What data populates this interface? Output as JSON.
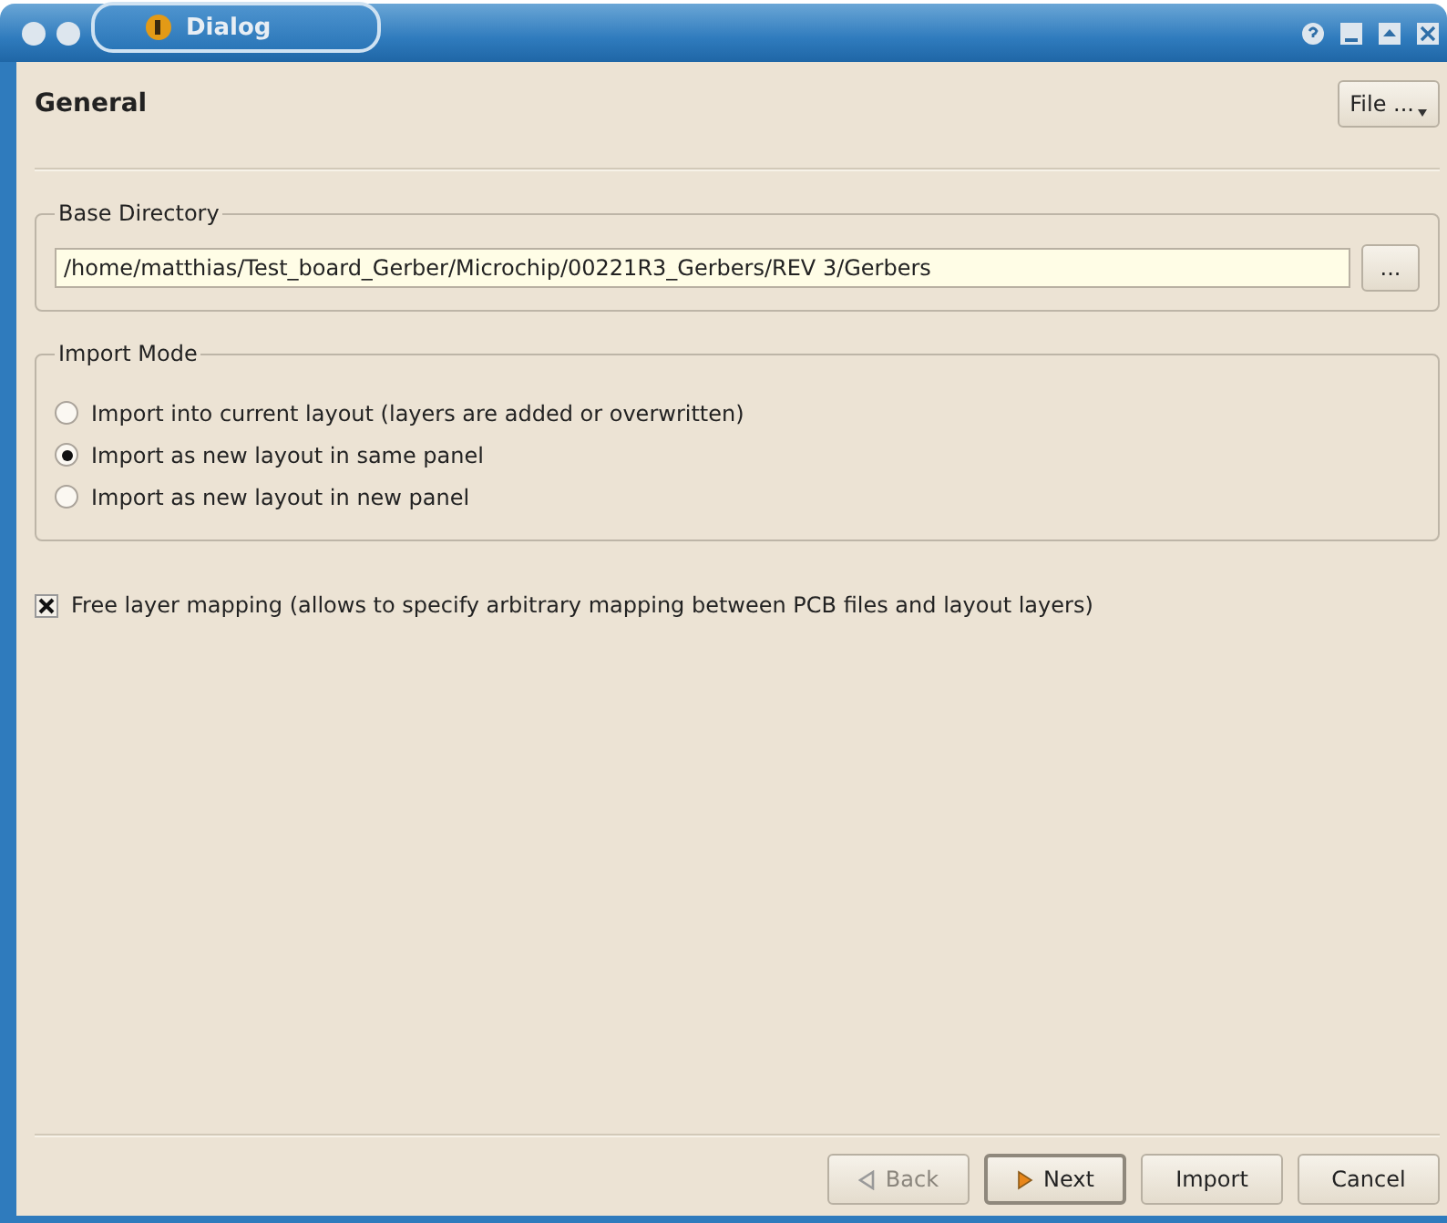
{
  "window": {
    "title": "Dialog"
  },
  "page": {
    "title": "General",
    "file_button": "File ..."
  },
  "base_directory": {
    "label": "Base Directory",
    "value": "/home/matthias/Test_board_Gerber/Microchip/00221R3_Gerbers/REV 3/Gerbers",
    "browse_button": "..."
  },
  "import_mode": {
    "label": "Import Mode",
    "options": [
      {
        "label": "Import into current layout (layers are added or overwritten)",
        "selected": false
      },
      {
        "label": "Import as new layout in same panel",
        "selected": true
      },
      {
        "label": "Import as new layout in new panel",
        "selected": false
      }
    ]
  },
  "free_layer_mapping": {
    "label": "Free layer mapping (allows to specify arbitrary mapping between PCB files and layout layers)",
    "checked": true
  },
  "buttons": [
    {
      "label": "Back",
      "kind": "back",
      "disabled": true,
      "default": false
    },
    {
      "label": "Next",
      "kind": "next",
      "disabled": false,
      "default": true
    },
    {
      "label": "Import",
      "kind": "plain",
      "disabled": false,
      "default": false
    },
    {
      "label": "Cancel",
      "kind": "plain",
      "disabled": false,
      "default": false
    }
  ]
}
